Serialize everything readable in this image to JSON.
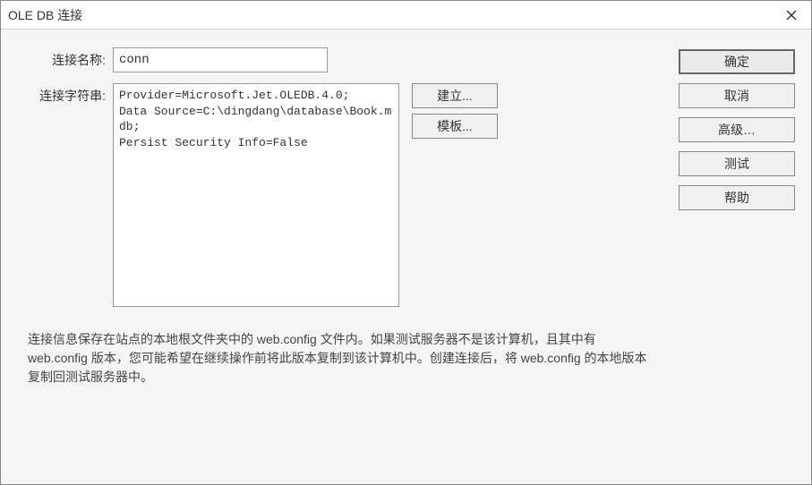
{
  "window": {
    "title": "OLE DB 连接"
  },
  "form": {
    "name_label": "连接名称:",
    "name_value": "conn",
    "connstr_label": "连接字符串:",
    "connstr_value": "Provider=Microsoft.Jet.OLEDB.4.0;\nData Source=C:\\dingdang\\database\\Book.mdb;\nPersist Security Info=False"
  },
  "mid_buttons": {
    "build": "建立...",
    "template": "模板..."
  },
  "info": "连接信息保存在站点的本地根文件夹中的 web.config 文件内。如果测试服务器不是该计算机，且其中有 web.config 版本，您可能希望在继续操作前将此版本复制到该计算机中。创建连接后，将 web.config 的本地版本复制回测试服务器中。",
  "right_buttons": {
    "ok": "确定",
    "cancel": "取消",
    "advanced": "高级…",
    "test": "测试",
    "help": "帮助"
  }
}
